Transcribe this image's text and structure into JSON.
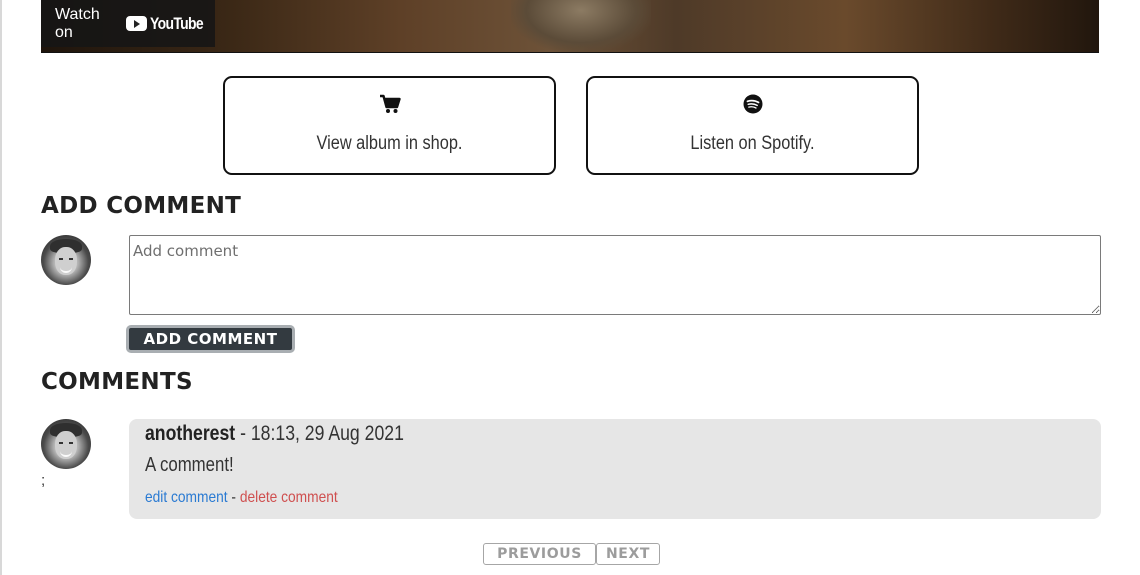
{
  "video": {
    "watch_label": "Watch on",
    "brand": "YouTube"
  },
  "links": {
    "shop": {
      "label": "View album in shop.",
      "icon": "shopping-cart-icon"
    },
    "spotify": {
      "label": "Listen on Spotify.",
      "icon": "spotify-icon"
    }
  },
  "add_comment": {
    "heading": "ADD COMMENT",
    "placeholder": "Add comment",
    "button_label": "ADD COMMENT"
  },
  "comments": {
    "heading": "COMMENTS",
    "stray_text": ";",
    "items": [
      {
        "username": "anotherest",
        "separator": " - ",
        "timestamp": "18:13, 29 Aug 2021",
        "text": "A comment!",
        "edit_label": "edit comment",
        "action_separator": " - ",
        "delete_label": "delete comment"
      }
    ]
  },
  "pagination": {
    "previous_label": "PREVIOUS",
    "next_label": "NEXT"
  },
  "colors": {
    "edit_link": "#2a7ad2",
    "delete_link": "#cf4f4f",
    "comment_bg": "#e6e6e6",
    "button_bg": "#333a40"
  }
}
